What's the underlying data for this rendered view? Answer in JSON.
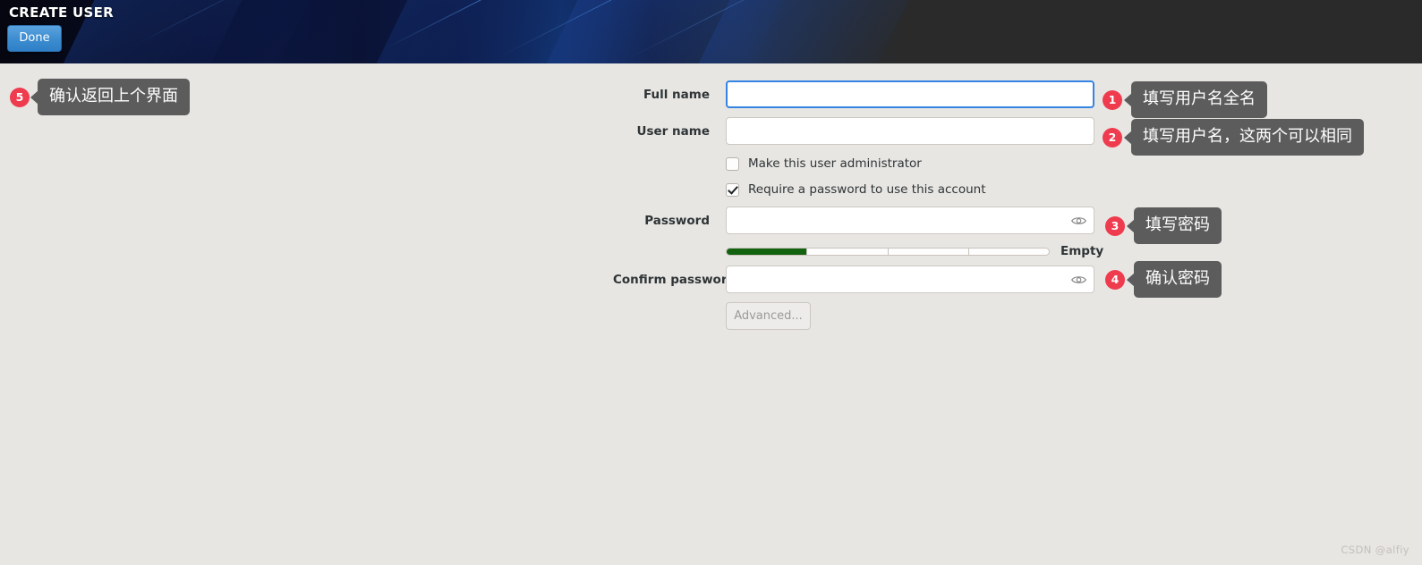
{
  "header": {
    "title": "CREATE USER",
    "done_label": "Done",
    "accent_button_color": "#3e8ed0",
    "banner_color": "#0c173f",
    "right_fill_color": "#2a2a2a"
  },
  "form": {
    "background_color": "#e8e6e3",
    "fields": [
      {
        "label": "Full name",
        "value": "",
        "placeholder": "",
        "focused": true
      },
      {
        "label": "User name",
        "value": "",
        "placeholder": "",
        "focused": false
      }
    ],
    "checkboxes": [
      {
        "label": "Make this user administrator",
        "checked": false
      },
      {
        "label": "Require a password to use this account",
        "checked": true
      }
    ],
    "password": {
      "label": "Password",
      "value": "",
      "placeholder": "",
      "reveal_icon": "eye-icon"
    },
    "confirm_password": {
      "label": "Confirm password",
      "value": "",
      "placeholder": "",
      "reveal_icon": "eye-icon"
    },
    "strength": {
      "text": "Empty",
      "segments": 4,
      "filled": 1,
      "fill_color": "#13620f"
    },
    "advanced_button": {
      "label": "Advanced...",
      "disabled": true
    }
  },
  "annotations": {
    "badge_color": "#ef3b4e",
    "bubble_color": "#5c5c5c",
    "items": [
      {
        "number": "1",
        "text": "填写用户名全名"
      },
      {
        "number": "2",
        "text": "填写用户名，这两个可以相同"
      },
      {
        "number": "3",
        "text": "填写密码"
      },
      {
        "number": "4",
        "text": "确认密码"
      },
      {
        "number": "5",
        "text": "确认返回上个界面"
      }
    ]
  },
  "watermark": {
    "text": "CSDN @alfiy"
  }
}
